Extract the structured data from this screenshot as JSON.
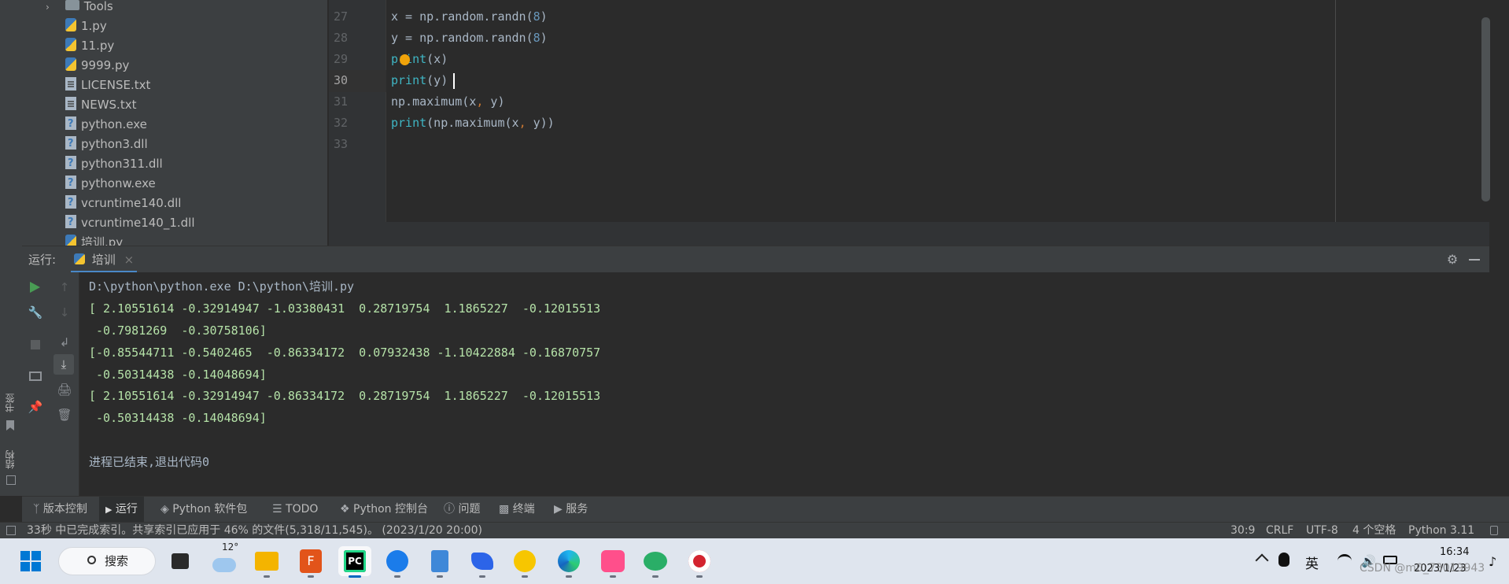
{
  "project_tree": {
    "items": [
      {
        "label": "Tools",
        "type": "folder"
      },
      {
        "label": "1.py",
        "type": "py"
      },
      {
        "label": "11.py",
        "type": "py"
      },
      {
        "label": "9999.py",
        "type": "py"
      },
      {
        "label": "LICENSE.txt",
        "type": "txt"
      },
      {
        "label": "NEWS.txt",
        "type": "txt"
      },
      {
        "label": "python.exe",
        "type": "unk"
      },
      {
        "label": "python3.dll",
        "type": "unk"
      },
      {
        "label": "python311.dll",
        "type": "unk"
      },
      {
        "label": "pythonw.exe",
        "type": "unk"
      },
      {
        "label": "vcruntime140.dll",
        "type": "unk"
      },
      {
        "label": "vcruntime140_1.dll",
        "type": "unk"
      },
      {
        "label": "培训.py",
        "type": "py"
      }
    ]
  },
  "left_strip": {
    "bookmarks_label": "书签",
    "structure_label": "结构"
  },
  "editor": {
    "lines": [
      {
        "num": "27",
        "code": "x = np.random.randn(8)"
      },
      {
        "num": "28",
        "code": "y = np.random.randn(8)"
      },
      {
        "num": "29",
        "code": "print(x)"
      },
      {
        "num": "30",
        "code": "print(y)"
      },
      {
        "num": "31",
        "code": "np.maximum(x, y)"
      },
      {
        "num": "32",
        "code": "print(np.maximum(x, y))"
      },
      {
        "num": "33",
        "code": ""
      }
    ]
  },
  "run": {
    "label": "运行:",
    "tab_name": "培训",
    "tab_close": "×",
    "settings_icon": "gear-icon",
    "minimize_icon": "minus-icon",
    "console": [
      "D:\\python\\python.exe D:\\python\\培训.py",
      "[ 2.10551614 -0.32914947 -1.03380431  0.28719754  1.1865227  -0.12015513",
      " -0.7981269  -0.30758106]",
      "[-0.85544711 -0.5402465  -0.86334172  0.07932438 -1.10422884 -0.16870757",
      " -0.50314438 -0.14048694]",
      "[ 2.10551614 -0.32914947 -0.86334172  0.28719754  1.1865227  -0.12015513",
      " -0.50314438 -0.14048694]",
      "",
      "进程已结束,退出代码0"
    ]
  },
  "tool_tabs": [
    {
      "label": "版本控制",
      "icon": "branch-icon"
    },
    {
      "label": "运行",
      "icon": "play-icon",
      "active": true
    },
    {
      "label": "Python 软件包",
      "icon": "packages-icon"
    },
    {
      "label": "TODO",
      "icon": "list-icon"
    },
    {
      "label": "Python 控制台",
      "icon": "python-console-icon"
    },
    {
      "label": "问题",
      "icon": "info-icon"
    },
    {
      "label": "终端",
      "icon": "terminal-icon"
    },
    {
      "label": "服务",
      "icon": "services-icon"
    }
  ],
  "status_bar": {
    "message": "33秒 中已完成索引。共享索引已应用于 46% 的文件(5,318/11,545)。 (2023/1/20 20:00)",
    "position": "30:9",
    "line_sep": "CRLF",
    "encoding": "UTF-8",
    "indent": "4 个空格",
    "interpreter": "Python 3.11"
  },
  "taskbar": {
    "search_label": "搜索",
    "weather_temp": "12°",
    "ime": "英",
    "time": "16:34",
    "date": "2023/1/23",
    "watermark": "CSDN @m0_73019943"
  },
  "colors": {
    "editor_bg": "#2b2b2b",
    "panel_bg": "#3c3f41",
    "console_text": "#b5e2a8",
    "function_color": "#3fb6c4",
    "number_color": "#6897bb"
  }
}
